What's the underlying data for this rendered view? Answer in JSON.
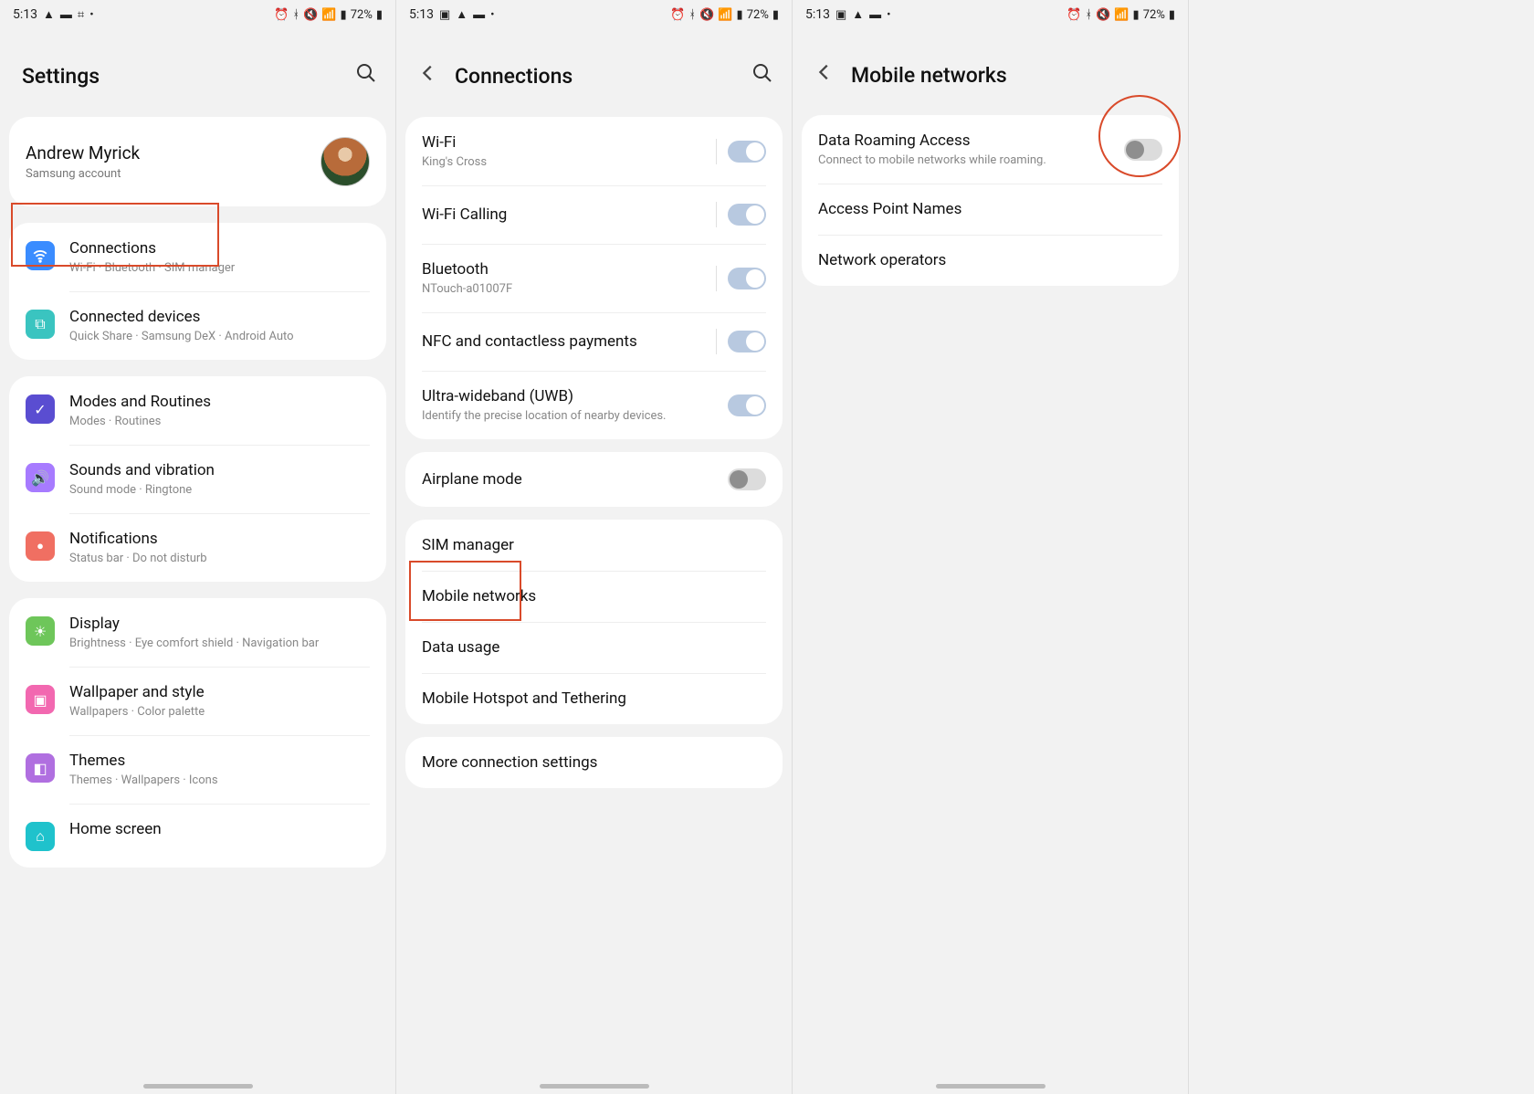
{
  "status": {
    "time": "5:13",
    "battery": "72%",
    "icons_left_1": [
      "arrow",
      "rect",
      "grid",
      "dot"
    ],
    "icons_left_23": [
      "image",
      "arrow",
      "rect",
      "dot"
    ],
    "icons_right": [
      "alarm",
      "bluetooth",
      "mute",
      "wifi",
      "signal",
      "battery"
    ]
  },
  "screen1": {
    "title": "Settings",
    "account": {
      "name": "Andrew Myrick",
      "sub": "Samsung account"
    },
    "group1": [
      {
        "key": "connections",
        "title": "Connections",
        "sub": "Wi-Fi · Bluetooth · SIM manager",
        "icon": "wifi",
        "color": "ic-blue"
      },
      {
        "key": "connected-devices",
        "title": "Connected devices",
        "sub": "Quick Share · Samsung DeX · Android Auto",
        "icon": "devices",
        "color": "ic-teal"
      }
    ],
    "group2": [
      {
        "key": "modes",
        "title": "Modes and Routines",
        "sub": "Modes · Routines",
        "icon": "check-circle",
        "color": "ic-purple-check"
      },
      {
        "key": "sounds",
        "title": "Sounds and vibration",
        "sub": "Sound mode · Ringtone",
        "icon": "speaker",
        "color": "ic-purple"
      },
      {
        "key": "notifications",
        "title": "Notifications",
        "sub": "Status bar · Do not disturb",
        "icon": "bell",
        "color": "ic-red"
      }
    ],
    "group3": [
      {
        "key": "display",
        "title": "Display",
        "sub": "Brightness · Eye comfort shield · Navigation bar",
        "icon": "sun",
        "color": "ic-green"
      },
      {
        "key": "wallpaper",
        "title": "Wallpaper and style",
        "sub": "Wallpapers · Color palette",
        "icon": "image",
        "color": "ic-pink"
      },
      {
        "key": "themes",
        "title": "Themes",
        "sub": "Themes · Wallpapers · Icons",
        "icon": "palette",
        "color": "ic-violet"
      },
      {
        "key": "home",
        "title": "Home screen",
        "sub": "",
        "icon": "home",
        "color": "ic-cyan"
      }
    ]
  },
  "screen2": {
    "title": "Connections",
    "group1": [
      {
        "key": "wifi",
        "title": "Wi-Fi",
        "sub": "King's Cross",
        "toggle": "on"
      },
      {
        "key": "wifi-calling",
        "title": "Wi-Fi Calling",
        "sub": "",
        "toggle": "on"
      },
      {
        "key": "bluetooth",
        "title": "Bluetooth",
        "sub": "NTouch-a01007F",
        "toggle": "on"
      },
      {
        "key": "nfc",
        "title": "NFC and contactless payments",
        "sub": "",
        "toggle": "on"
      },
      {
        "key": "uwb",
        "title": "Ultra-wideband (UWB)",
        "sub": "Identify the precise location of nearby devices.",
        "toggle": "on"
      }
    ],
    "group2": [
      {
        "key": "airplane",
        "title": "Airplane mode",
        "sub": "",
        "toggle": "off"
      }
    ],
    "group3": [
      {
        "key": "sim",
        "title": "SIM manager"
      },
      {
        "key": "mobile-networks",
        "title": "Mobile networks"
      },
      {
        "key": "data-usage",
        "title": "Data usage"
      },
      {
        "key": "hotspot",
        "title": "Mobile Hotspot and Tethering"
      }
    ],
    "group4": [
      {
        "key": "more",
        "title": "More connection settings"
      }
    ]
  },
  "screen3": {
    "title": "Mobile networks",
    "group1": [
      {
        "key": "roaming",
        "title": "Data Roaming Access",
        "sub": "Connect to mobile networks while roaming.",
        "toggle": "off"
      },
      {
        "key": "apn",
        "title": "Access Point Names"
      },
      {
        "key": "operators",
        "title": "Network operators"
      }
    ]
  }
}
